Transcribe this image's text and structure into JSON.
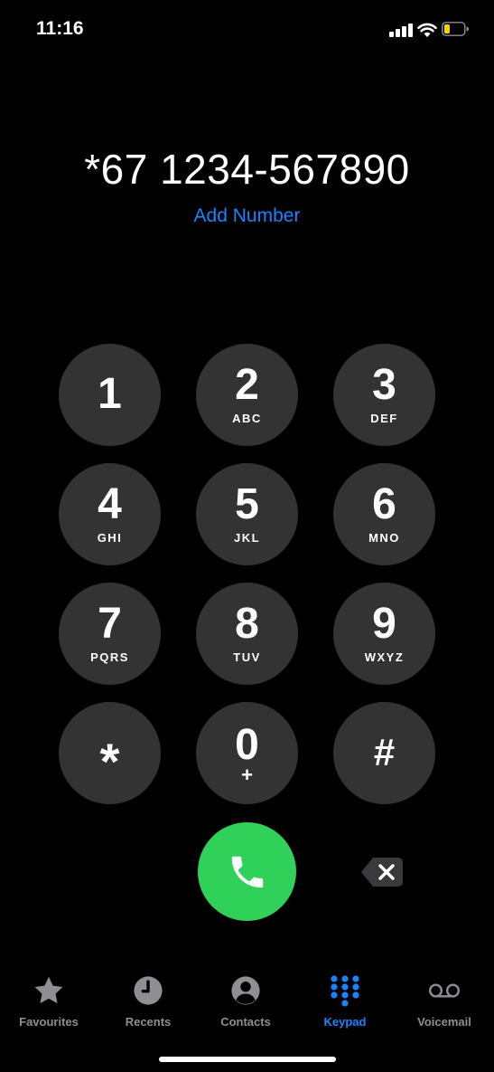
{
  "status_bar": {
    "time": "11:16",
    "icons": [
      "cellular-signal-icon",
      "wifi-icon",
      "battery-icon"
    ],
    "battery_color": "#f5d300"
  },
  "dialer": {
    "number": "*67 1234-567890",
    "add_number_label": "Add Number"
  },
  "keypad": {
    "keys": [
      {
        "digit": "1",
        "letters": ""
      },
      {
        "digit": "2",
        "letters": "ABC"
      },
      {
        "digit": "3",
        "letters": "DEF"
      },
      {
        "digit": "4",
        "letters": "GHI"
      },
      {
        "digit": "5",
        "letters": "JKL"
      },
      {
        "digit": "6",
        "letters": "MNO"
      },
      {
        "digit": "7",
        "letters": "PQRS"
      },
      {
        "digit": "8",
        "letters": "TUV"
      },
      {
        "digit": "9",
        "letters": "WXYZ"
      },
      {
        "digit": "*",
        "letters": ""
      },
      {
        "digit": "0",
        "letters": "+"
      },
      {
        "digit": "#",
        "letters": ""
      }
    ]
  },
  "actions": {
    "call_icon": "phone-icon",
    "delete_icon": "delete-backspace-icon",
    "call_color": "#30d158"
  },
  "tab_bar": {
    "tabs": [
      {
        "label": "Favourites",
        "icon": "star-icon",
        "active": false
      },
      {
        "label": "Recents",
        "icon": "clock-icon",
        "active": false
      },
      {
        "label": "Contacts",
        "icon": "person-circle-icon",
        "active": false
      },
      {
        "label": "Keypad",
        "icon": "keypad-grid-icon",
        "active": true
      },
      {
        "label": "Voicemail",
        "icon": "voicemail-icon",
        "active": false
      }
    ],
    "active_color": "#1a84ff",
    "inactive_color": "#8e8e93"
  }
}
